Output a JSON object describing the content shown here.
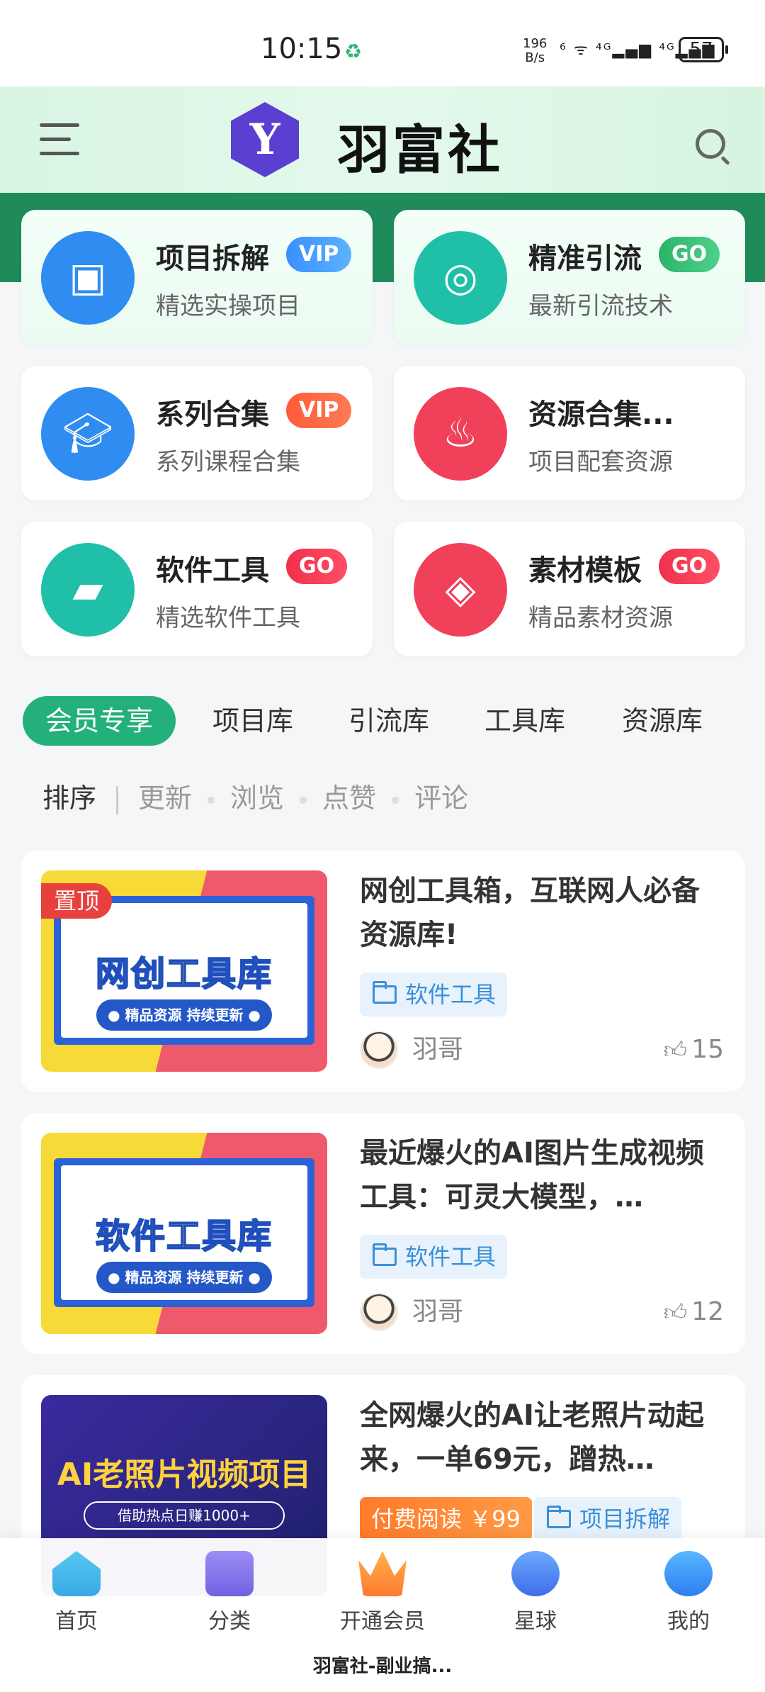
{
  "status_bar": {
    "time": "10:15",
    "net_rate_top": "196",
    "net_rate_bottom": "B/s",
    "signals": "⁶ ᯤ ⁴ᴳ▂▄▆ ⁴ᴳ▂▄▆",
    "battery": "57"
  },
  "header": {
    "logo_letter": "Y",
    "brand": "羽富社"
  },
  "grid": [
    {
      "title": "项目拆解",
      "badge": "VIP",
      "subtitle": "精选实操项目",
      "icon": "cube-icon",
      "color": "#2f8cf0"
    },
    {
      "title": "精准引流",
      "badge": "GO",
      "subtitle": "最新引流技术",
      "icon": "chrome-icon",
      "color": "#1fbfa8"
    },
    {
      "title": "系列合集",
      "badge": "VIP",
      "subtitle": "系列课程合集",
      "icon": "graduation-cap-icon",
      "color": "#2f8cf0"
    },
    {
      "title": "资源合集...",
      "badge": "",
      "subtitle": "项目配套资源",
      "icon": "flame-icon",
      "color": "#f0405a"
    },
    {
      "title": "软件工具",
      "badge": "GO",
      "subtitle": "精选软件工具",
      "icon": "tool-icon",
      "color": "#1fbfa8"
    },
    {
      "title": "素材模板",
      "badge": "GO",
      "subtitle": "精品素材资源",
      "icon": "template-icon",
      "color": "#f0405a"
    }
  ],
  "tabs": [
    "会员专享",
    "项目库",
    "引流库",
    "工具库",
    "资源库"
  ],
  "sort": {
    "label": "排序",
    "options": [
      "更新",
      "浏览",
      "点赞",
      "评论"
    ]
  },
  "articles": [
    {
      "pinned_label": "置顶",
      "thumb_title": "网创工具库",
      "thumb_pill": "● 精品资源 持续更新 ●",
      "title": "网创工具箱，互联网人必备资源库!",
      "tag": "软件工具",
      "author": "羽哥",
      "likes": "15"
    },
    {
      "thumb_title": "软件工具库",
      "thumb_pill": "● 精品资源 持续更新 ●",
      "title": "最近爆火的AI图片生成视频工具：可灵大模型，…",
      "tag": "软件工具",
      "author": "羽哥",
      "likes": "12"
    },
    {
      "thumb_title": "AI老照片视频项目",
      "thumb_pill": "借助热点日赚1000+",
      "title": "全网爆火的AI让老照片动起来，一单69元，蹭热…",
      "paid_tag": "付费阅读 ￥99",
      "tag": "项目拆解"
    }
  ],
  "bottom_nav": [
    {
      "label": "首页",
      "icon": "home-icon"
    },
    {
      "label": "分类",
      "icon": "category-icon"
    },
    {
      "label": "开通会员",
      "icon": "crown-icon"
    },
    {
      "label": "星球",
      "icon": "planet-badge-icon"
    },
    {
      "label": "我的",
      "icon": "profile-icon"
    }
  ],
  "app_caption": "羽富社-副业搞..."
}
